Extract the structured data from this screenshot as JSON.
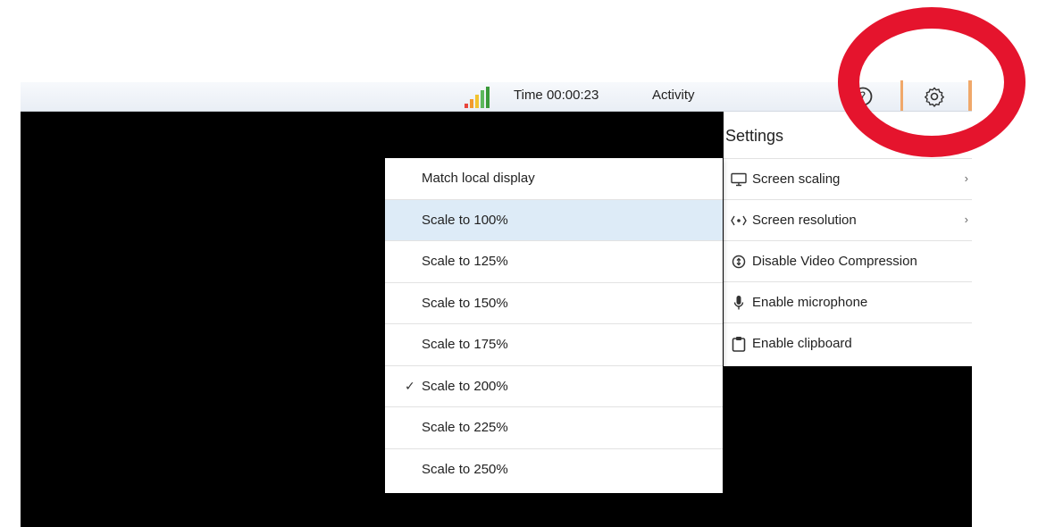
{
  "toolbar": {
    "time_label": "Time 00:00:23",
    "activity_label": "Activity",
    "icons": [
      "signal-strength-icon",
      "help-icon",
      "gear-icon"
    ]
  },
  "settings": {
    "title": "Settings",
    "items": [
      {
        "label": "Screen scaling",
        "icon": "monitor-icon",
        "has_submenu": true
      },
      {
        "label": "Screen resolution",
        "icon": "resolution-icon",
        "has_submenu": true
      },
      {
        "label": "Disable Video Compression",
        "icon": "compression-icon",
        "has_submenu": false
      },
      {
        "label": "Enable microphone",
        "icon": "microphone-icon",
        "has_submenu": false
      },
      {
        "label": "Enable clipboard",
        "icon": "clipboard-icon",
        "has_submenu": false
      }
    ]
  },
  "scaling_menu": {
    "items": [
      {
        "label": "Match local display",
        "checked": false,
        "highlighted": false
      },
      {
        "label": "Scale to 100%",
        "checked": false,
        "highlighted": true
      },
      {
        "label": "Scale to 125%",
        "checked": false,
        "highlighted": false
      },
      {
        "label": "Scale to 150%",
        "checked": false,
        "highlighted": false
      },
      {
        "label": "Scale to 175%",
        "checked": false,
        "highlighted": false
      },
      {
        "label": "Scale to 200%",
        "checked": true,
        "highlighted": false
      },
      {
        "label": "Scale to 225%",
        "checked": false,
        "highlighted": false
      },
      {
        "label": "Scale to 250%",
        "checked": false,
        "highlighted": false
      }
    ],
    "check_glyph": "✓"
  },
  "colors": {
    "annotation_ring": "#e5142d",
    "highlight": "#ddebf7",
    "toolbar_divider": "#f0a86a"
  }
}
